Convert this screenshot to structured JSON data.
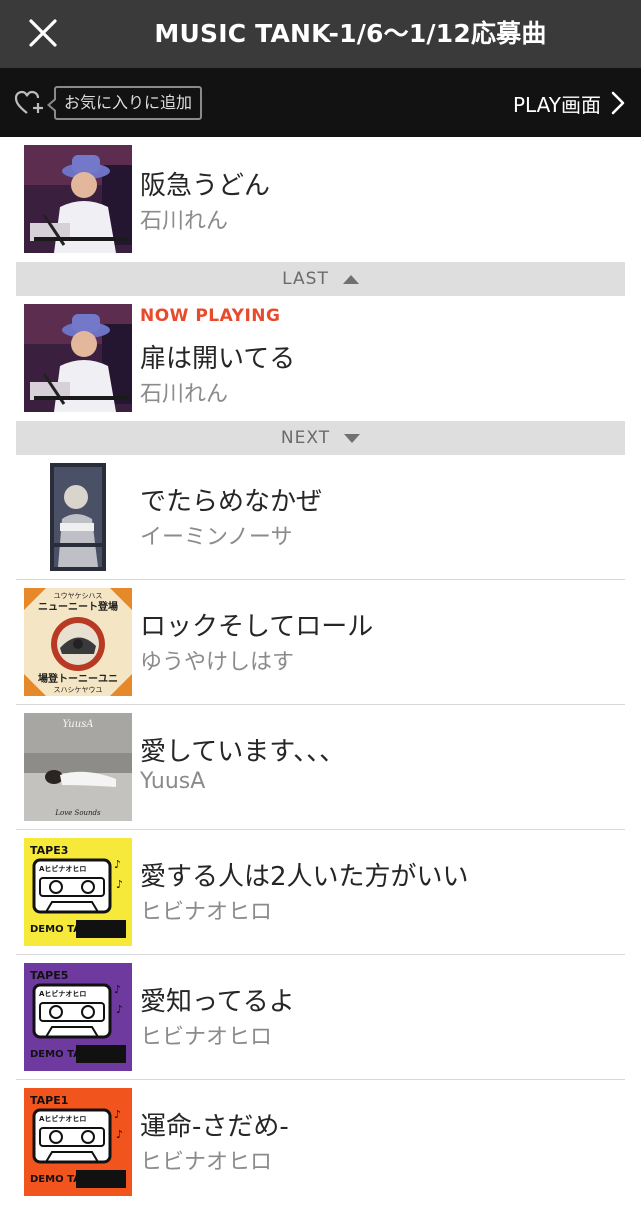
{
  "header": {
    "title": "MUSIC TANK-1/6〜1/12応募曲",
    "close_icon": "close-icon"
  },
  "toolbar": {
    "favorite_label": "お気に入りに追加",
    "favorite_icon": "heart-plus-icon",
    "play_screen_label": "PLAY画面",
    "play_screen_icon": "chevron-right-icon"
  },
  "previous_track": {
    "title": "阪急うどん",
    "artist": "石川れん"
  },
  "last_divider": {
    "label": "LAST",
    "icon": "caret-up-icon"
  },
  "current_track": {
    "status": "NOW PLAYING",
    "title": "扉は開いてる",
    "artist": "石川れん"
  },
  "next_divider": {
    "label": "NEXT",
    "icon": "caret-down-icon"
  },
  "upcoming": [
    {
      "title": "でたらめなかぜ",
      "artist": "イーミンノーサ"
    },
    {
      "title": "ロックそしてロール",
      "artist": "ゆうやけしはす",
      "art_top": "ユウヤケシハス",
      "art_mid": "ニューニート登場",
      "art_bottom": "場登トーニーユニ",
      "art_bottom2": "スハシケヤウユ"
    },
    {
      "title": "愛しています、、、",
      "artist": "YuusA",
      "art_top": "YuusA",
      "art_bottom": "Love Sounds"
    },
    {
      "title": "愛する人は2人いた方がいい",
      "artist": "ヒビナオヒロ",
      "art_top": "TAPE3",
      "art_mid": "Aヒビナオヒロ",
      "art_bottom": "DEMO TAPE"
    },
    {
      "title": "愛知ってるよ",
      "artist": "ヒビナオヒロ",
      "art_top": "TAPE5",
      "art_mid": "Aヒビナオヒロ",
      "art_bottom": "DEMO TAPE"
    },
    {
      "title": "運命-さだめ-",
      "artist": "ヒビナオヒロ",
      "art_top": "TAPE1",
      "art_mid": "Aヒビナオヒロ",
      "art_bottom": "DEMO TAPE"
    }
  ],
  "colors": {
    "title_bar": "#3a3a3a",
    "toolbar": "#121212",
    "now_playing": "#e84a2c",
    "divider": "#dedede",
    "tape3": "#f6e93a",
    "tape5": "#6e3aa0",
    "tape1": "#f2541d"
  }
}
